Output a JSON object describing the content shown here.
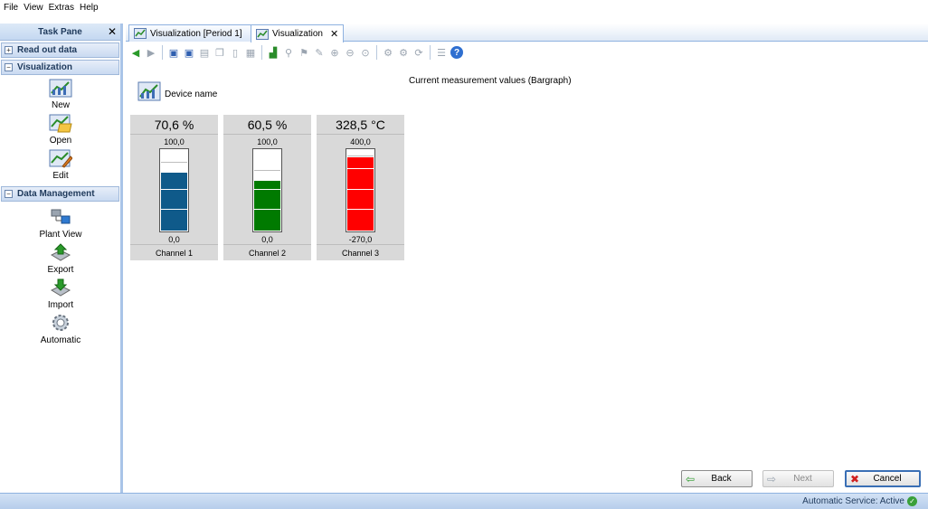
{
  "menu": {
    "file": "File",
    "view": "View",
    "extras": "Extras",
    "help": "Help"
  },
  "taskpane": {
    "title": "Task Pane",
    "sections": {
      "read_out_data": "Read out data",
      "visualization": "Visualization",
      "data_management": "Data Management"
    },
    "visualization_items": [
      "New",
      "Open",
      "Edit"
    ],
    "data_management_items": [
      "Plant View",
      "Export",
      "Import",
      "Automatic"
    ]
  },
  "tabs": [
    {
      "label": "Visualization [Period 1]",
      "active": false
    },
    {
      "label": "Visualization",
      "active": true
    }
  ],
  "content": {
    "title": "Current measurement values (Bargraph)",
    "device_name": "Device name"
  },
  "chart_data": {
    "type": "bar",
    "title": "Current measurement values (Bargraph)",
    "gauges": [
      {
        "channel": "Channel 1",
        "value_label": "70,6 %",
        "value": 70.6,
        "min": 0,
        "max": 100,
        "min_label": "0,0",
        "max_label": "100,0",
        "color": "#0f5a8a"
      },
      {
        "channel": "Channel 2",
        "value_label": "60,5 %",
        "value": 60.5,
        "min": 0,
        "max": 100,
        "min_label": "0,0",
        "max_label": "100,0",
        "color": "#007a00"
      },
      {
        "channel": "Channel 3",
        "value_label": "328,5 °C",
        "value": 328.5,
        "min": -270,
        "max": 400,
        "min_label": "-270,0",
        "max_label": "400,0",
        "color": "#ff0000"
      }
    ]
  },
  "buttons": {
    "back": "Back",
    "next": "Next",
    "cancel": "Cancel"
  },
  "status": {
    "text": "Automatic Service: Active"
  }
}
